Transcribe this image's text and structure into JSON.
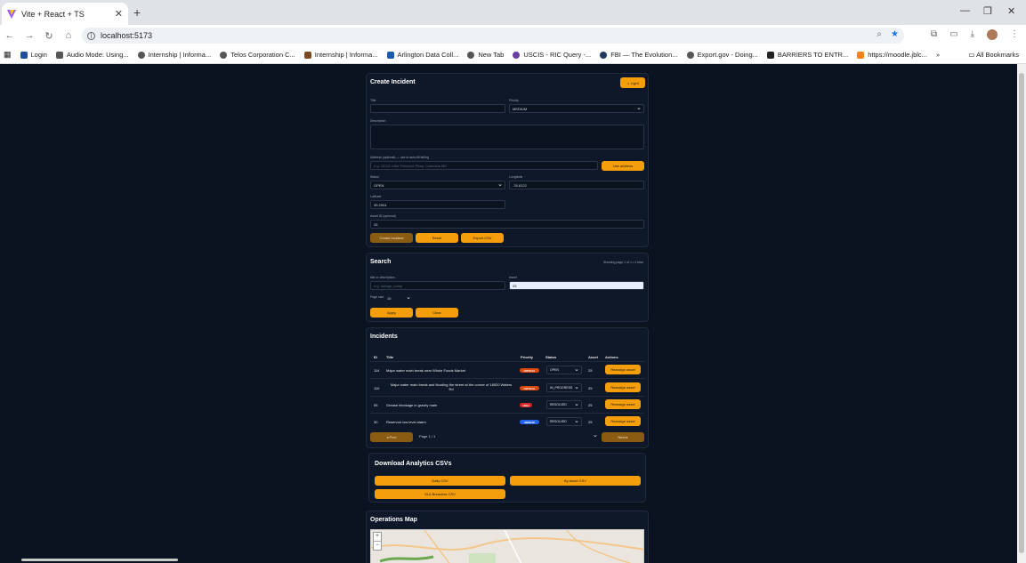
{
  "browser": {
    "tab_title": "Vite + React + TS",
    "url": "localhost:5173",
    "bookmarks": [
      "Login",
      "Audio Mode: Using...",
      "Internship | Informa...",
      "Telos Corporation C...",
      "Internship | Informa...",
      "Arlington Data Coll...",
      "New Tab",
      "USCIS - RIC Query -...",
      "FBI — The Evolution...",
      "Export.gov - Doing...",
      "BARRIERS TO ENTR...",
      "https://moodle.jblc..."
    ],
    "all_bookmarks": "All Bookmarks"
  },
  "create": {
    "title": "Create Incident",
    "theme_button": "☼ Light",
    "title_label": "Title",
    "priority_label": "Priority",
    "priority_value": "MEDIUM",
    "description_label": "Description",
    "address_label": "Address (optional) — use to auto-fill lat/lng",
    "address_placeholder": "e.g. 10100 Little Patuxent Pkwy, Columbia MD",
    "use_address": "Use address",
    "status_label": "Status",
    "status_value": "OPEN",
    "longitude_label": "Longitude",
    "longitude_value": "-76.8122",
    "latitude_label": "Latitude",
    "latitude_value": "39.2904",
    "asset_label": "Asset ID (optional)",
    "asset_value": "25",
    "create_btn": "Create incident",
    "reset_btn": "Reset",
    "export_btn": "Export CSV"
  },
  "search": {
    "title": "Search",
    "showing": "Showing page 1 of 1 • 4 total",
    "query_label": "title or description...",
    "query_placeholder": "e.g. outage, pump",
    "asset_label": "Asset",
    "asset_value": "25",
    "page_size_label": "Page size",
    "page_size_value": "10",
    "apply_btn": "Apply",
    "clear_btn": "Clear"
  },
  "incidents": {
    "title": "Incidents",
    "headers": {
      "id": "ID",
      "title": "Title",
      "priority": "Priority",
      "status": "Status",
      "asset": "Asset",
      "actions": "Actions"
    },
    "rows": [
      {
        "id": "114",
        "title": "Major water main break near Whole Foods Market",
        "priority": "CRITICAL",
        "status": "OPEN",
        "asset": "25",
        "action": "Reassign asset"
      },
      {
        "id": "110",
        "title": "Major water main break and flooding the street at the corner of 18520 Waters Rd",
        "priority": "CRITICAL",
        "status": "IN_PROGRESS",
        "asset": "25",
        "action": "Reassign asset"
      },
      {
        "id": "55",
        "title": "Grease blockage in gravity main",
        "priority": "HIGH",
        "status": "RESOLVED",
        "asset": "25",
        "action": "Reassign asset"
      },
      {
        "id": "30",
        "title": "Reservoir low level alarm",
        "priority": "MEDIUM",
        "status": "RESOLVED",
        "asset": "25",
        "action": "Reassign asset"
      }
    ],
    "prev_btn": "◂ Prev",
    "page_label": "Page 1 / 1",
    "next_btn": "Next ▸"
  },
  "analytics": {
    "title": "Download Analytics CSVs",
    "daily_btn": "Daily CSV",
    "asset_btn": "By Asset CSV",
    "sla_btn": "SLA Breaches CSV"
  },
  "map": {
    "title": "Operations Map",
    "zoom_in": "+",
    "zoom_out": "−"
  },
  "colors": {
    "accent": "#f59e0b",
    "critical": "#d9480f",
    "high": "#dc2626",
    "medium": "#2563eb",
    "background": "#0b1220",
    "card": "#0f1829"
  }
}
